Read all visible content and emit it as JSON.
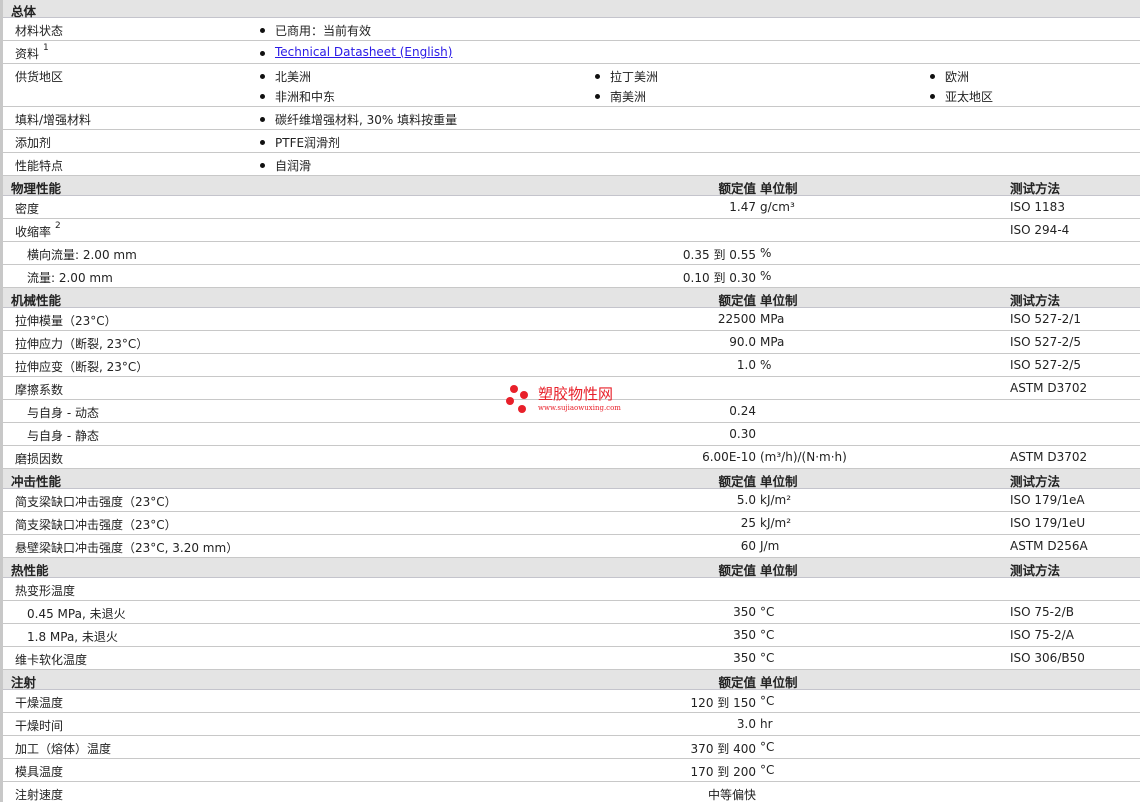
{
  "general": {
    "title": "总体",
    "rows": [
      {
        "label": "材料状态",
        "items": [
          "已商用：当前有效"
        ]
      },
      {
        "label": "资料",
        "sup": "1",
        "link": "Technical Datasheet (English)"
      },
      {
        "label": "供货地区",
        "regions": [
          "北美洲",
          "拉丁美洲",
          "欧洲",
          "非洲和中东",
          "南美洲",
          "亚太地区"
        ]
      },
      {
        "label": "填料/增强材料",
        "items": [
          "碳纤维增强材料, 30% 填料按重量"
        ]
      },
      {
        "label": "添加剂",
        "items": [
          "PTFE润滑剂"
        ]
      },
      {
        "label": "性能特点",
        "items": [
          "自润滑"
        ]
      }
    ]
  },
  "col_headers": {
    "value": "额定值",
    "unit": "单位制",
    "test": "测试方法"
  },
  "sections": [
    {
      "title": "物理性能",
      "show_test": true,
      "rows": [
        {
          "label": "密度",
          "value": "1.47",
          "unit": "g/cm³",
          "test": "ISO 1183"
        },
        {
          "label": "收缩率",
          "sup": "2",
          "value": "",
          "unit": "",
          "test": "ISO 294-4"
        },
        {
          "label": "横向流量: 2.00 mm",
          "indent": true,
          "value": "0.35 到  0.55",
          "unit": "%",
          "test": ""
        },
        {
          "label": "流量: 2.00 mm",
          "indent": true,
          "value": "0.10 到  0.30",
          "unit": "%",
          "test": ""
        }
      ]
    },
    {
      "title": "机械性能",
      "show_test": true,
      "rows": [
        {
          "label": "拉伸模量（23°C）",
          "value": "22500",
          "unit": "MPa",
          "test": "ISO 527-2/1"
        },
        {
          "label": "拉伸应力（断裂, 23°C）",
          "value": "90.0",
          "unit": "MPa",
          "test": "ISO 527-2/5"
        },
        {
          "label": "拉伸应变（断裂, 23°C）",
          "value": "1.0",
          "unit": "%",
          "test": "ISO 527-2/5"
        },
        {
          "label": "摩擦系数",
          "value": "",
          "unit": "",
          "test": "ASTM D3702"
        },
        {
          "label": "与自身  - 动态",
          "indent": true,
          "value": "0.24",
          "unit": "",
          "test": ""
        },
        {
          "label": "与自身  - 静态",
          "indent": true,
          "value": "0.30",
          "unit": "",
          "test": ""
        },
        {
          "label": "磨损因数",
          "value": "6.00E-10",
          "unit": "(m³/h)/(N·m·h)",
          "test": "ASTM D3702"
        }
      ]
    },
    {
      "title": "冲击性能",
      "show_test": true,
      "rows": [
        {
          "label": "简支梁缺口冲击强度（23°C）",
          "value": "5.0",
          "unit": "kJ/m²",
          "test": "ISO 179/1eA"
        },
        {
          "label": "简支梁缺口冲击强度（23°C）",
          "value": "25",
          "unit": "kJ/m²",
          "test": "ISO 179/1eU"
        },
        {
          "label": "悬壁梁缺口冲击强度（23°C, 3.20 mm）",
          "value": "60",
          "unit": "J/m",
          "test": "ASTM D256A"
        }
      ]
    },
    {
      "title": "热性能",
      "show_test": true,
      "rows": [
        {
          "label": "热变形温度",
          "value": "",
          "unit": "",
          "test": ""
        },
        {
          "label": "0.45 MPa, 未退火",
          "indent": true,
          "value": "350",
          "unit": "°C",
          "test": "ISO 75-2/B"
        },
        {
          "label": "1.8 MPa, 未退火",
          "indent": true,
          "value": "350",
          "unit": "°C",
          "test": "ISO 75-2/A"
        },
        {
          "label": "维卡软化温度",
          "value": "350",
          "unit": "°C",
          "test": "ISO 306/B50"
        }
      ]
    },
    {
      "title": "注射",
      "show_test": false,
      "rows": [
        {
          "label": "干燥温度",
          "value": "120 到  150",
          "unit": "°C",
          "test": ""
        },
        {
          "label": "干燥时间",
          "value": "3.0",
          "unit": "hr",
          "test": ""
        },
        {
          "label": "加工（熔体）温度",
          "value": "370 到  400",
          "unit": "°C",
          "test": ""
        },
        {
          "label": "模具温度",
          "value": "170 到  200",
          "unit": "°C",
          "test": ""
        },
        {
          "label": "注射速度",
          "value": "中等偏快",
          "unit": "",
          "test": ""
        }
      ]
    }
  ],
  "watermark": {
    "name": "塑胶物性网",
    "url": "www.sujiaowuxing.com"
  }
}
